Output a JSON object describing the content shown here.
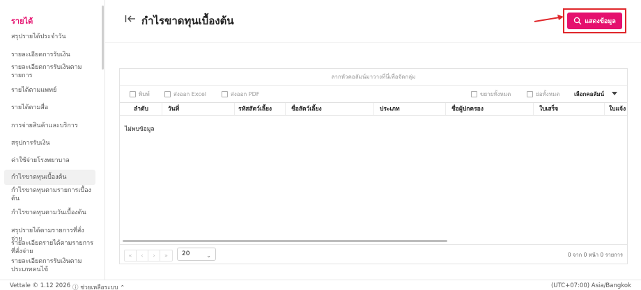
{
  "sidebar": {
    "title": "รายได้",
    "items": [
      "สรุปรายได้ประจำวัน",
      "รายละเอียดการรับเงิน",
      "รายละเอียดการรับเงินตาม รายการ",
      "รายได้ตามแพทย์",
      "รายได้ตามสื่อ",
      "การจ่ายสินค้าและบริการ",
      "สรุปการรับเงิน",
      "ค่าใช้จ่ายโรงพยาบาล",
      "กำไรขาดทุนเบื้องต้น",
      "กำไรขาดทุนตามรายการเบื้อง ต้น",
      "กำไรขาดทุนตามวันเบื้องต้น",
      "สรุปรายได้ตามรายการที่สั่งจ่าย",
      "รายละเอียดรายได้ตามรายการ ที่สั่งจ่าย",
      "รายละเอียดการรับเงินตาม ประเภทคนไข้"
    ]
  },
  "header": {
    "title": "กำไรขาดทุนเบื้องต้น",
    "show_button": "แสดงข้อมูล"
  },
  "grid": {
    "group_hint": "ลากหัวคอลัมน์มาวางที่นี่เพื่อจัดกลุ่ม",
    "toolbar": {
      "print": "พิมพ์",
      "export_excel": "ส่งออก Excel",
      "export_pdf": "ส่งออก PDF",
      "expand_all": "ขยายทั้งหมด",
      "collapse_all": "ย่อทั้งหมด",
      "choose_columns": "เลือกคอลัมน์"
    },
    "columns": [
      "ลำดับ",
      "วันที่",
      "รหัสสัตว์เลี้ยง",
      "ชื่อสัตว์เลี้ยง",
      "ประเภท",
      "ชื่อผู้ปกครอง",
      "ใบเสร็จ",
      "ใบแจ้ง"
    ],
    "empty_text": "ไม่พบข้อมูล",
    "pager": {
      "page_size": "20",
      "info": "0 จาก 0 หน้า 0 รายการ"
    }
  },
  "footer": {
    "version": "Vettale © 1.12 2026",
    "help": "ⓘ ช่วยเหลือระบบ ⌃",
    "timezone": "(UTC+07:00) Asia/Bangkok"
  },
  "colors": {
    "accent": "#e5106e",
    "highlight_border": "#e0262a"
  }
}
